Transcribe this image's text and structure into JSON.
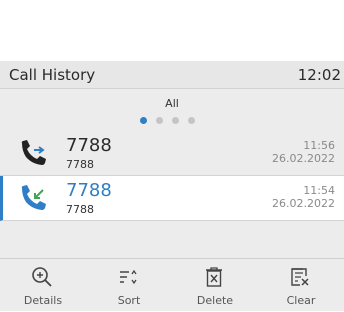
{
  "header": {
    "title": "Call History",
    "time": "12:02"
  },
  "filter": {
    "label": "All",
    "page_count": 4,
    "active_page": 1
  },
  "calls": [
    {
      "name": "7788",
      "number": "7788",
      "time": "11:56",
      "date": "26.02.2022",
      "type": "outgoing",
      "selected": false
    },
    {
      "name": "7788",
      "number": "7788",
      "time": "11:54",
      "date": "26.02.2022",
      "type": "incoming",
      "selected": true
    }
  ],
  "softkeys": [
    {
      "label": "Details",
      "icon": "zoom-in-icon"
    },
    {
      "label": "Sort",
      "icon": "sort-icon"
    },
    {
      "label": "Delete",
      "icon": "delete-icon"
    },
    {
      "label": "Clear",
      "icon": "clear-list-icon"
    }
  ],
  "colors": {
    "accent": "#2e7fc7",
    "outgoing_arrow": "#2e7fc7",
    "incoming_arrow": "#3aa856",
    "phone_dark": "#222222"
  }
}
